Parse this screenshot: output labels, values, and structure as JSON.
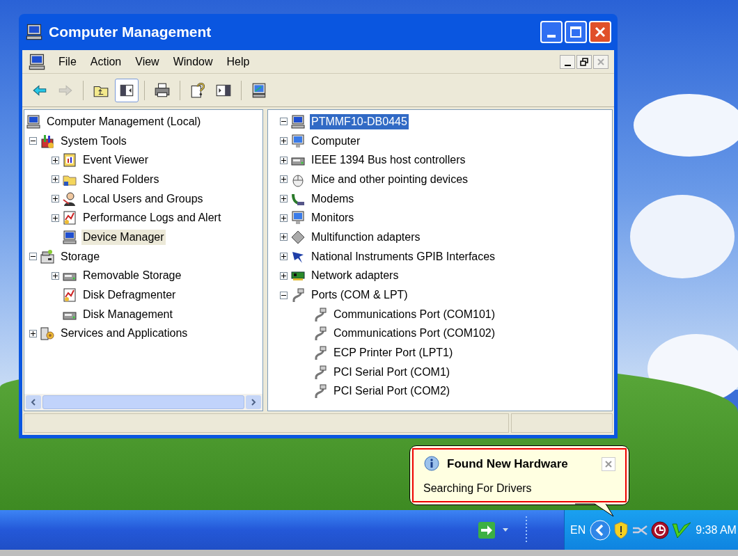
{
  "window": {
    "title": "Computer Management"
  },
  "menu": [
    "File",
    "Action",
    "View",
    "Window",
    "Help"
  ],
  "toolbar": [
    {
      "kind": "back",
      "disabled": false,
      "pressed": false
    },
    {
      "kind": "forward",
      "disabled": true,
      "pressed": false
    },
    {
      "kind": "up",
      "disabled": false,
      "pressed": false
    },
    {
      "kind": "tree",
      "disabled": false,
      "pressed": true
    },
    {
      "kind": "print",
      "disabled": false,
      "pressed": false
    },
    {
      "kind": "help",
      "disabled": false,
      "pressed": false
    },
    {
      "kind": "panel",
      "disabled": false,
      "pressed": false
    },
    {
      "kind": "computer",
      "disabled": false,
      "pressed": false
    }
  ],
  "left_pane": {
    "focused": false,
    "tree": [
      {
        "label": "Computer Management (Local)",
        "kind": "computer",
        "selected": false,
        "children": [
          {
            "label": "System Tools",
            "kind": "tools",
            "selected": false,
            "expanded": true,
            "children": [
              {
                "label": "Event Viewer",
                "kind": "log",
                "selected": false,
                "expanded": false
              },
              {
                "label": "Shared Folders",
                "kind": "folder",
                "selected": false,
                "expanded": false
              },
              {
                "label": "Local Users and Groups",
                "kind": "users",
                "selected": false,
                "expanded": false
              },
              {
                "label": "Performance Logs and Alert",
                "kind": "chart",
                "selected": false,
                "expanded": false
              },
              {
                "label": "Device Manager",
                "kind": "computer",
                "selected": true
              }
            ]
          },
          {
            "label": "Storage",
            "kind": "storage",
            "selected": false,
            "expanded": true,
            "children": [
              {
                "label": "Removable Storage",
                "kind": "disk",
                "selected": false,
                "expanded": false
              },
              {
                "label": "Disk Defragmenter",
                "kind": "chart",
                "selected": false
              },
              {
                "label": "Disk Management",
                "kind": "disk",
                "selected": false
              }
            ]
          },
          {
            "label": "Services and Applications",
            "kind": "gear",
            "selected": false,
            "expanded": false
          }
        ]
      }
    ]
  },
  "right_pane": {
    "focused": true,
    "tree": [
      {
        "label": "PTMMF10-DB0445",
        "kind": "computer",
        "selected": true,
        "expanded": true,
        "children": [
          {
            "label": "Computer",
            "kind": "monitor",
            "selected": false,
            "expanded": false
          },
          {
            "label": "IEEE 1394 Bus host controllers",
            "kind": "disk",
            "selected": false,
            "expanded": false
          },
          {
            "label": "Mice and other pointing devices",
            "kind": "mouse",
            "selected": false,
            "expanded": false
          },
          {
            "label": "Modems",
            "kind": "modem",
            "selected": false,
            "expanded": false
          },
          {
            "label": "Monitors",
            "kind": "monitor",
            "selected": false,
            "expanded": false
          },
          {
            "label": "Multifunction adapters",
            "kind": "diamond",
            "selected": false,
            "expanded": false
          },
          {
            "label": "National Instruments GPIB Interfaces",
            "kind": "antenna",
            "selected": false,
            "expanded": false
          },
          {
            "label": "Network adapters",
            "kind": "card",
            "selected": false,
            "expanded": false
          },
          {
            "label": "Ports (COM & LPT)",
            "kind": "port",
            "selected": false,
            "expanded": true,
            "children": [
              {
                "label": "Communications Port (COM101)",
                "kind": "port",
                "selected": false
              },
              {
                "label": "Communications Port (COM102)",
                "kind": "port",
                "selected": false
              },
              {
                "label": "ECP Printer Port (LPT1)",
                "kind": "port",
                "selected": false
              },
              {
                "label": "PCI Serial Port (COM1)",
                "kind": "port",
                "selected": false
              },
              {
                "label": "PCI Serial Port (COM2)",
                "kind": "port",
                "selected": false
              }
            ]
          }
        ]
      }
    ]
  },
  "balloon": {
    "title": "Found New Hardware",
    "message": "Searching For Drivers"
  },
  "taskbar": {
    "language": "EN",
    "clock": "9:38 AM"
  }
}
